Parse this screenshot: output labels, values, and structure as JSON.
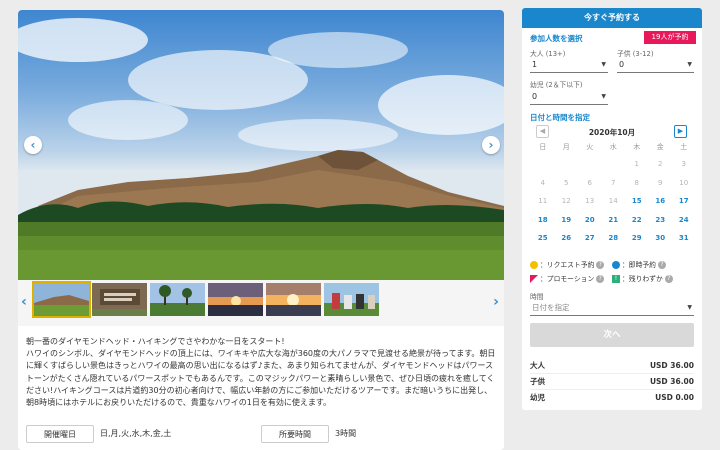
{
  "gallery": {
    "prev_icon": "‹",
    "next_icon": "›"
  },
  "description": "朝一番のダイヤモンドヘッド・ハイキングでさやわかな一日をスタート!\nハワイのシンボル、ダイヤモンドヘッドの頂上には、ワイキキや広大な海が360度の大パノラマで見渡せる絶景が待ってます。朝日に輝くすばらしい景色はきっとハワイの最高の思い出になるはず♪また、あまり知られてませんが、ダイヤモンドヘッドはパワーストーンがたくさん隠れているパワースポットでもあるんです。このマジックパワーと素晴らしい景色で、ぜひ日頃の疲れを癒してください!ハイキングコースは片道約30分の初心者向けで、幅広い年齢の方にご参加いただけるツアーです。まだ暗いうちに出発し、朝8時頃にはホテルにお戻りいただけるので、貴重なハワイの1日を有効に使えます。",
  "info": {
    "days_label": "開催曜日",
    "days_value": "日,月,火,水,木,金,土",
    "duration_label": "所要時間",
    "duration_value": "3時間"
  },
  "booking": {
    "header": "今すぐ予約する",
    "participants_title": "参加人数を選択",
    "badge": "19人が予約",
    "adult_label": "大人 (13+)",
    "adult_value": "1",
    "child_label": "子供 (3-12)",
    "child_value": "0",
    "infant_label": "幼児 (2＆下以下)",
    "infant_value": "0",
    "date_title": "日付と時間を指定",
    "month": "2020年10月",
    "weekdays": [
      "日",
      "月",
      "火",
      "水",
      "木",
      "金",
      "土"
    ],
    "weeks": [
      [
        "",
        "",
        "",
        "",
        "1",
        "2",
        "3"
      ],
      [
        "4",
        "5",
        "6",
        "7",
        "8",
        "9",
        "10"
      ],
      [
        "11",
        "12",
        "13",
        "14",
        "15",
        "16",
        "17"
      ],
      [
        "18",
        "19",
        "20",
        "21",
        "22",
        "23",
        "24"
      ],
      [
        "25",
        "26",
        "27",
        "28",
        "29",
        "30",
        "31"
      ]
    ],
    "first_available_day": 15,
    "legend_request": "：リクエスト予約",
    "legend_instant": "：即時予約",
    "legend_promo": "：プロモーション",
    "legend_few": "：残りわずか",
    "time_label": "時間",
    "time_placeholder": "日付を指定",
    "next_button": "次へ",
    "prices": [
      {
        "label": "大人",
        "amount": "USD 36.00"
      },
      {
        "label": "子供",
        "amount": "USD 36.00"
      },
      {
        "label": "幼児",
        "amount": "USD 0.00"
      }
    ]
  },
  "colors": {
    "accent": "#1a87cc",
    "badge": "#e8185b",
    "request": "#f3c000",
    "instant": "#1a87cc",
    "promo": "#e8185b",
    "few": "#2bb07a"
  }
}
